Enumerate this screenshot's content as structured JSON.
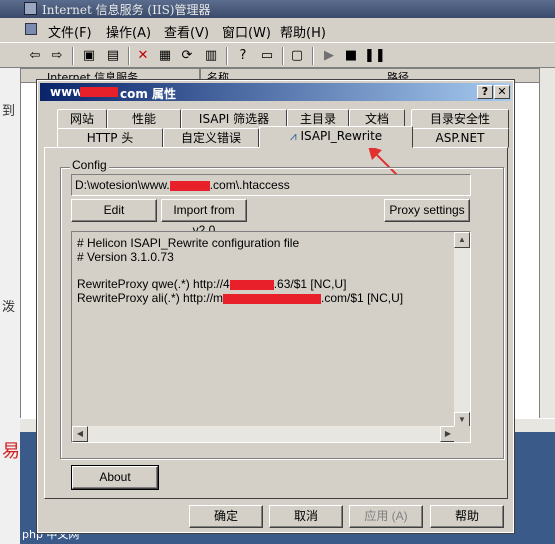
{
  "iis": {
    "title": "Internet 信息服务 (IIS)管理器",
    "menu": [
      "文件(F)",
      "操作(A)",
      "查看(V)",
      "窗口(W)",
      "帮助(H)"
    ],
    "tree_header": "Internet 信息服务",
    "list_header_name": "名称",
    "list_header_path": "路径",
    "left_chars": [
      "到",
      "泼"
    ],
    "red_char": "易",
    "php_text": "php 中文网"
  },
  "dialog": {
    "title_prefix": "www.",
    "title_suffix": "com 属性",
    "help_btn": "?",
    "close_btn": "✕",
    "tabs_row1": [
      "网站",
      "性能",
      "ISAPI 筛选器",
      "主目录",
      "文档",
      "目录安全性"
    ],
    "tabs_row2": [
      "HTTP 头",
      "自定义错误",
      "ISAPI_Rewrite",
      "ASP.NET"
    ],
    "active_tab": "ISAPI_Rewrite",
    "config_label": "Config",
    "config_path_prefix": "D:\\wotesion\\www.",
    "config_path_suffix": ".com\\.htaccess",
    "buttons": {
      "edit": "Edit",
      "import": "Import from v2.0",
      "proxy": "Proxy settings",
      "about": "About"
    },
    "config_lines": [
      "# Helicon ISAPI_Rewrite configuration file",
      "# Version 3.1.0.73"
    ],
    "rule1_prefix": "RewriteProxy qwe(.*) http://4",
    "rule1_suffix": ".63/$1 [NC,U]",
    "rule2_prefix": "RewriteProxy ali(.*) http://m",
    "rule2_suffix": ".com/$1 [NC,U]",
    "footer": {
      "ok": "确定",
      "cancel": "取消",
      "apply": "应用",
      "apply_key": "(A)",
      "help": "帮助"
    }
  },
  "colors": {
    "title_gradient_start": "#0a246a",
    "redaction": "#e8202a",
    "annotation_arrow": "#e03030"
  }
}
